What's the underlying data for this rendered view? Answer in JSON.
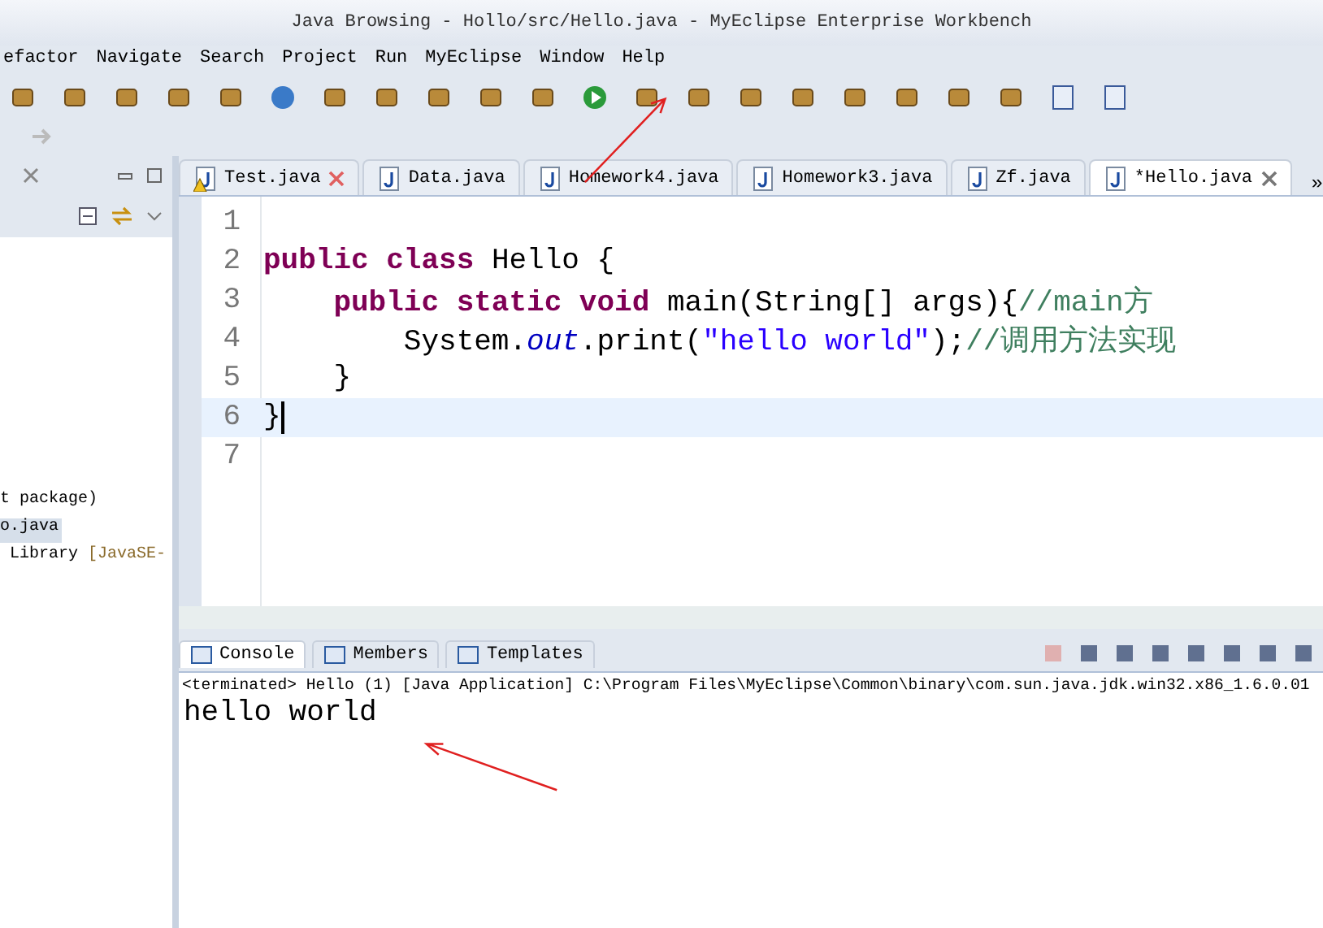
{
  "window": {
    "title": "Java Browsing - Hollo/src/Hello.java - MyEclipse Enterprise Workbench"
  },
  "menu": [
    "efactor",
    "Navigate",
    "Search",
    "Project",
    "Run",
    "MyEclipse",
    "Window",
    "Help"
  ],
  "explorer": {
    "items": [
      {
        "text": "t package)",
        "selected": false
      },
      {
        "text": "o.java",
        "selected": true
      },
      {
        "text": " Library ",
        "selected": false,
        "suffix": "[JavaSE-"
      }
    ]
  },
  "editor_tabs": [
    {
      "label": "Test.java",
      "selected": false,
      "error": true
    },
    {
      "label": "Data.java",
      "selected": false,
      "error": false
    },
    {
      "label": "Homework4.java",
      "selected": false,
      "error": false
    },
    {
      "label": "Homework3.java",
      "selected": false,
      "error": false
    },
    {
      "label": "Zf.java",
      "selected": false,
      "error": false
    },
    {
      "label": "*Hello.java",
      "selected": true,
      "error": false
    }
  ],
  "overflow": "»",
  "code": [
    {
      "number": "1",
      "current": false
    },
    {
      "number": "2",
      "current": false,
      "tokens": [
        {
          "kind": "keyword",
          "text": "public class "
        },
        {
          "kind": "plain",
          "text": "Hello "
        },
        {
          "kind": "bracket",
          "text": "{"
        }
      ]
    },
    {
      "number": "3",
      "current": false,
      "tokens": [
        {
          "kind": "keyword",
          "text": "    public static void "
        },
        {
          "kind": "plain",
          "text": "main(String[] args){"
        },
        {
          "kind": "comment",
          "text": "//main方"
        }
      ]
    },
    {
      "number": "4",
      "current": false,
      "tokens": [
        {
          "kind": "plain",
          "text": "        System."
        },
        {
          "kind": "field",
          "text": "out"
        },
        {
          "kind": "plain",
          "text": ".print("
        },
        {
          "kind": "string",
          "text": "\"hello world\""
        },
        {
          "kind": "plain",
          "text": ");"
        },
        {
          "kind": "comment",
          "text": "//调用方法实现"
        }
      ]
    },
    {
      "number": "5",
      "current": false,
      "tokens": [
        {
          "kind": "plain",
          "text": "    }"
        }
      ]
    },
    {
      "number": "6",
      "current": true,
      "tokens": [
        {
          "kind": "plain",
          "text": "}"
        }
      ]
    },
    {
      "number": "7",
      "current": false
    }
  ],
  "console_tabs": [
    {
      "label": "Console",
      "selected": true
    },
    {
      "label": "Members",
      "selected": false
    },
    {
      "label": "Templates",
      "selected": false
    }
  ],
  "console": {
    "status": "<terminated> Hello (1) [Java Application] C:\\Program Files\\MyEclipse\\Common\\binary\\com.sun.java.jdk.win32.x86_1.6.0.01",
    "output": "hello world"
  }
}
